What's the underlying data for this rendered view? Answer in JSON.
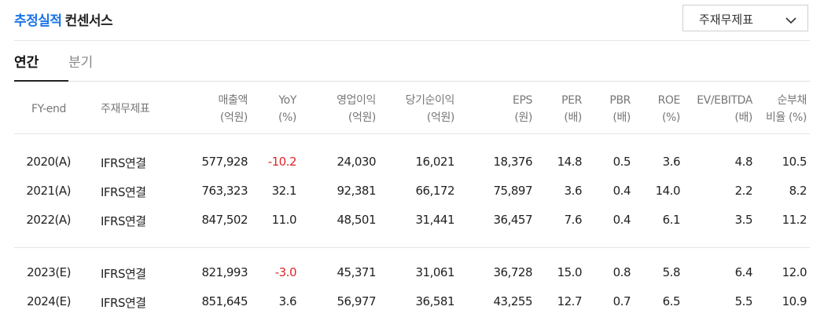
{
  "header": {
    "title_accent": "추정실적",
    "title_rest": "컨센서스"
  },
  "dropdown": {
    "selected": "주재무제표",
    "icon": "chevron-down-icon"
  },
  "tabs": [
    {
      "label": "연간",
      "active": true
    },
    {
      "label": "분기",
      "active": false
    }
  ],
  "colors": {
    "accent": "#1a73e8",
    "negative": "#e0262b"
  },
  "columns": [
    {
      "line1": "FY-end",
      "line2": ""
    },
    {
      "line1": "주재무제표",
      "line2": ""
    },
    {
      "line1": "매출액",
      "line2": "(억원)"
    },
    {
      "line1": "YoY",
      "line2": "(%)"
    },
    {
      "line1": "영업이익",
      "line2": "(억원)"
    },
    {
      "line1": "당기순이익",
      "line2": "(억원)"
    },
    {
      "line1": "EPS",
      "line2": "(원)"
    },
    {
      "line1": "PER",
      "line2": "(배)"
    },
    {
      "line1": "PBR",
      "line2": "(배)"
    },
    {
      "line1": "ROE",
      "line2": "(%)"
    },
    {
      "line1": "EV/EBITDA",
      "line2": "(배)"
    },
    {
      "line1": "순부채",
      "line2": "비율 (%)"
    }
  ],
  "rows": [
    {
      "fy": "2020(A)",
      "basis": "IFRS연결",
      "sales": "577,928",
      "yoy": "-10.2",
      "op": "24,030",
      "net": "16,021",
      "eps": "18,376",
      "per": "14.8",
      "pbr": "0.5",
      "roe": "3.6",
      "ev": "4.8",
      "debt": "10.5"
    },
    {
      "fy": "2021(A)",
      "basis": "IFRS연결",
      "sales": "763,323",
      "yoy": "32.1",
      "op": "92,381",
      "net": "66,172",
      "eps": "75,897",
      "per": "3.6",
      "pbr": "0.4",
      "roe": "14.0",
      "ev": "2.2",
      "debt": "8.2"
    },
    {
      "fy": "2022(A)",
      "basis": "IFRS연결",
      "sales": "847,502",
      "yoy": "11.0",
      "op": "48,501",
      "net": "31,441",
      "eps": "36,457",
      "per": "7.6",
      "pbr": "0.4",
      "roe": "6.1",
      "ev": "3.5",
      "debt": "11.2"
    },
    {
      "fy": "2023(E)",
      "basis": "IFRS연결",
      "sales": "821,993",
      "yoy": "-3.0",
      "op": "45,371",
      "net": "31,061",
      "eps": "36,728",
      "per": "15.0",
      "pbr": "0.8",
      "roe": "5.8",
      "ev": "6.4",
      "debt": "12.0"
    },
    {
      "fy": "2024(E)",
      "basis": "IFRS연결",
      "sales": "851,645",
      "yoy": "3.6",
      "op": "56,977",
      "net": "36,581",
      "eps": "43,255",
      "per": "12.7",
      "pbr": "0.7",
      "roe": "6.5",
      "ev": "5.5",
      "debt": "10.9"
    }
  ]
}
